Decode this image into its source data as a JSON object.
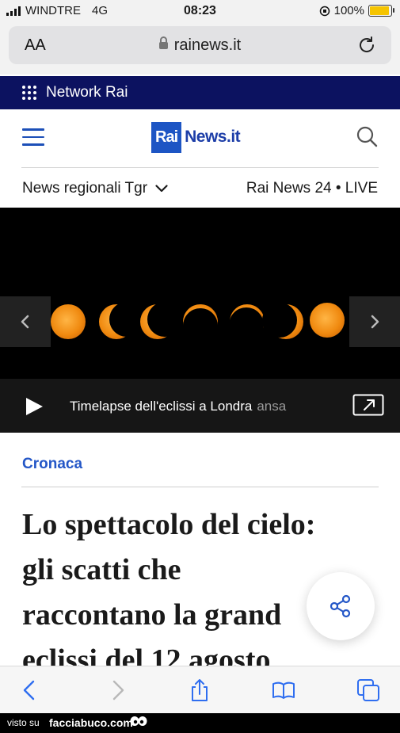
{
  "status_bar": {
    "carrier": "WINDTRE",
    "network": "4G",
    "time": "08:23",
    "battery": "100%",
    "battery_level": 1.0
  },
  "browser": {
    "text_size_label": "AA",
    "domain": "rainews.it"
  },
  "network_bar": {
    "label": "Network Rai"
  },
  "header": {
    "logo_rai": "Rai",
    "logo_news": "News.it"
  },
  "subnav": {
    "regional": "News regionali Tgr",
    "live": "Rai News 24 • LIVE"
  },
  "video": {
    "title": "Timelapse dell'eclissi a Londra",
    "source": "ansa"
  },
  "article": {
    "section": "Cronaca",
    "headline_lines": [
      "Lo spettacolo del cielo:",
      "gli scatti che",
      "raccontano la grand",
      "eclissi del 12 agosto"
    ]
  },
  "footer": {
    "visto": "visto su",
    "site": "facciabuco.com"
  },
  "colors": {
    "network_bg": "#0c1260",
    "brand_blue": "#1d55c4",
    "link_blue": "#2457c7"
  }
}
